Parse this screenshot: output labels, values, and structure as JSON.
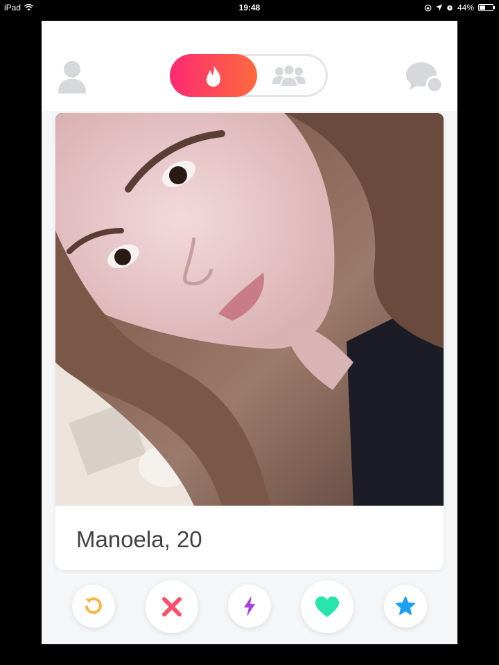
{
  "status_bar": {
    "device": "iPad",
    "time": "19:48",
    "battery_text": "44%",
    "battery_level": 0.44
  },
  "header": {
    "icons": [
      "profile-icon",
      "flame-icon",
      "social-icon",
      "chat-icon"
    ],
    "active_mode": "flame"
  },
  "card": {
    "name": "Manoela",
    "separator": ", ",
    "age": "20"
  },
  "actions": {
    "buttons": [
      {
        "icon": "rewind-icon",
        "color": "#f5b748"
      },
      {
        "icon": "nope-icon",
        "color": "#fd5068"
      },
      {
        "icon": "boost-icon",
        "color": "#a93ee0"
      },
      {
        "icon": "like-icon",
        "color": "#27e5ac"
      },
      {
        "icon": "super-like-icon",
        "color": "#1da1f2"
      }
    ]
  },
  "colors": {
    "brand_gradient_start": "#fd2a73",
    "brand_gradient_end": "#ff6a3d",
    "inactive_icon": "#d6d8dc",
    "background": "#f5f6f8"
  }
}
